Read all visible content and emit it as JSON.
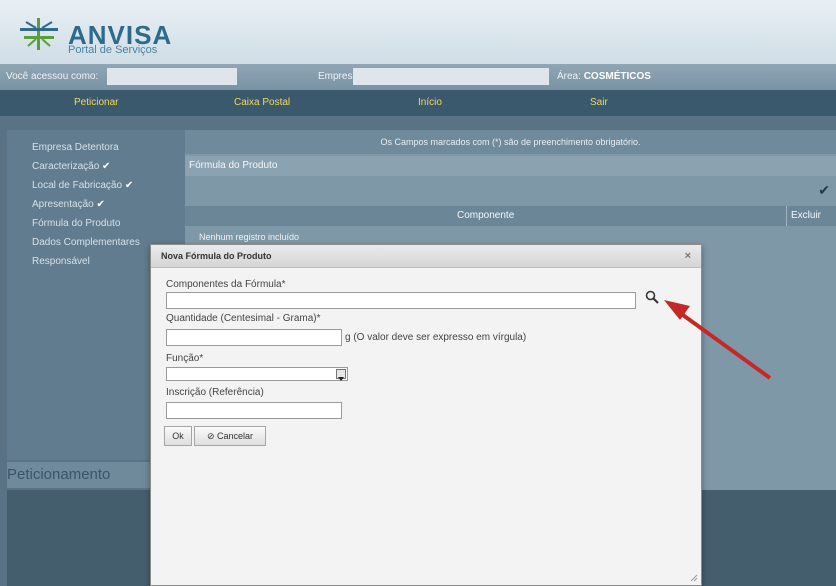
{
  "header": {
    "logo_title": "ANVISA",
    "logo_subtitle": "Portal de Serviços"
  },
  "access_bar": {
    "user_label": "Você acessou como:",
    "company_label": "Empresa:",
    "area_label": "Área:",
    "area_value": "COSMÉTICOS"
  },
  "menu": {
    "items": [
      {
        "label": "Peticionar"
      },
      {
        "label": "Caixa Postal"
      },
      {
        "label": "Início"
      },
      {
        "label": "Sair"
      }
    ]
  },
  "sidebar": {
    "items": [
      {
        "label": "Empresa Detentora",
        "check": ""
      },
      {
        "label": "Caracterização",
        "check": "✔"
      },
      {
        "label": "Local de Fabricação",
        "check": "✔"
      },
      {
        "label": "Apresentação",
        "check": "✔"
      },
      {
        "label": "Fórmula do Produto",
        "check": ""
      },
      {
        "label": "Dados Complementares",
        "check": ""
      },
      {
        "label": "Responsável",
        "check": ""
      }
    ],
    "footer": "Peticionamento"
  },
  "panel": {
    "notice": "Os Campos marcados com (*) são de preenchimento obrigatório.",
    "form_header": "Fórmula do Produto",
    "check": "✔",
    "col_component": "Componente",
    "col_delete": "Excluir",
    "empty": "Nenhum registro incluído"
  },
  "dialog": {
    "title": "Nova Fórmula do Produto",
    "close": "×",
    "components_label": "Componentes da Fórmula*",
    "quantity_label": "Quantidade (Centesimal - Grama)*",
    "quantity_hint": "g (O valor deve ser expresso em vírgula)",
    "function_label": "Função*",
    "inscription_label": "Inscrição (Referência)",
    "ok_label": "Ok",
    "cancel_label": "⊘ Cancelar"
  },
  "colors": {
    "accent_arrow": "#c62828",
    "menu_text": "#f1d95b"
  }
}
